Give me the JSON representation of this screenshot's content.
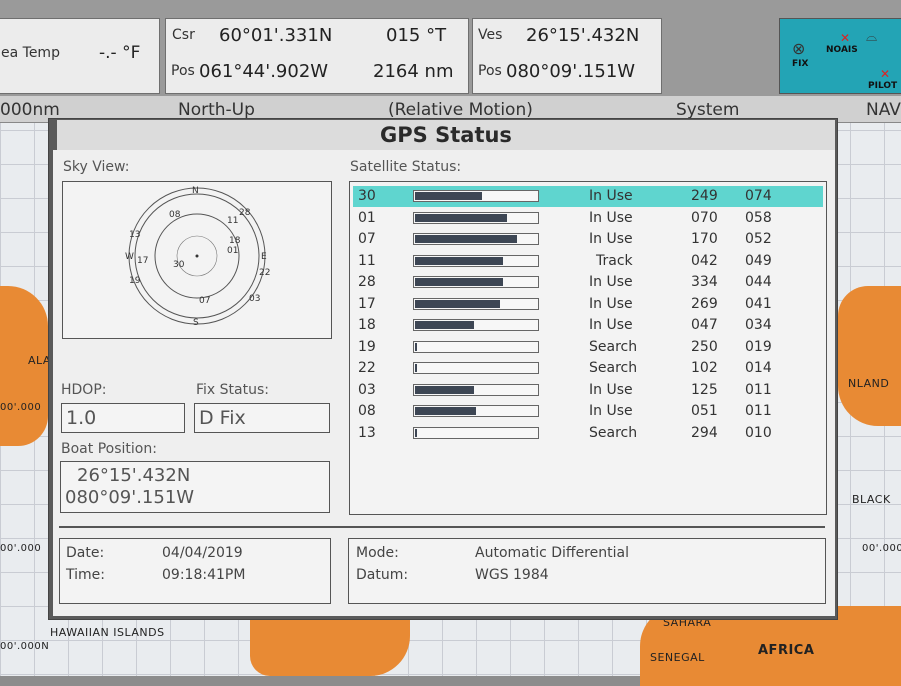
{
  "top_bar": {
    "sea_temp_label": "ea Temp",
    "sea_temp_value": "-.- °F",
    "csr_label": "Csr",
    "csr_lat": "60°01'.331N",
    "csr_course": "015 °T",
    "pos_label_1": "Pos",
    "csr_lon": "061°44'.902W",
    "csr_dist": "2164 nm",
    "ves_label": "Ves",
    "ves_lat": "26°15'.432N",
    "pos_label_2": "Pos",
    "ves_lon": "080°09'.151W",
    "fix_label": "FIX",
    "noais_label": "NOAIS",
    "pilot_label": "PILOT"
  },
  "chart_strip": {
    "range": "000nm",
    "orientation": "North-Up",
    "motion": "(Relative Motion)",
    "source": "System",
    "nav": "NAV"
  },
  "map_labels": {
    "ala": "ALA",
    "nland": "NLAND",
    "black": "BLACK",
    "hawaiian": "HAWAIIAN ISLANDS",
    "sahara": "SAHARA",
    "senegal": "SENEGAL",
    "africa": "AFRICA",
    "coord_1": "00'.000",
    "coord_2": "00'.000",
    "coord_3": "00'.000N",
    "coord_4": "00'.000"
  },
  "dialog": {
    "title": "GPS Status",
    "sky_view_label": "Sky View:",
    "satellite_status_label": "Satellite Status:",
    "compass": {
      "n": "N",
      "s": "S",
      "e": "E",
      "w": "W"
    },
    "sky_sats": [
      "08",
      "11",
      "13",
      "17",
      "30",
      "22",
      "03",
      "01",
      "07",
      "28",
      "18",
      "19"
    ],
    "hdop_label": "HDOP:",
    "hdop_value": "1.0",
    "fix_status_label": "Fix Status:",
    "fix_status_value": "D Fix",
    "boat_position_label": "Boat Position:",
    "boat_lat": "26°15'.432N",
    "boat_lon": "080°09'.151W",
    "date_label": "Date:",
    "date_value": "04/04/2019",
    "time_label": "Time:",
    "time_value": "09:18:41PM",
    "mode_label": "Mode:",
    "mode_value": "Automatic Differential",
    "datum_label": "Datum:",
    "datum_value": "WGS 1984"
  },
  "satellites": [
    {
      "prn": "30",
      "signal": 0.55,
      "status": "In Use",
      "azimuth": "249",
      "elevation": "074",
      "selected": true
    },
    {
      "prn": "01",
      "signal": 0.75,
      "status": "In Use",
      "azimuth": "070",
      "elevation": "058"
    },
    {
      "prn": "07",
      "signal": 0.84,
      "status": "In Use",
      "azimuth": "170",
      "elevation": "052"
    },
    {
      "prn": "11",
      "signal": 0.72,
      "status": "Track",
      "azimuth": "042",
      "elevation": "049"
    },
    {
      "prn": "28",
      "signal": 0.72,
      "status": "In Use",
      "azimuth": "334",
      "elevation": "044"
    },
    {
      "prn": "17",
      "signal": 0.7,
      "status": "In Use",
      "azimuth": "269",
      "elevation": "041"
    },
    {
      "prn": "18",
      "signal": 0.48,
      "status": "In Use",
      "azimuth": "047",
      "elevation": "034"
    },
    {
      "prn": "19",
      "signal": 0.02,
      "status": "Search",
      "azimuth": "250",
      "elevation": "019"
    },
    {
      "prn": "22",
      "signal": 0.02,
      "status": "Search",
      "azimuth": "102",
      "elevation": "014"
    },
    {
      "prn": "03",
      "signal": 0.48,
      "status": "In Use",
      "azimuth": "125",
      "elevation": "011"
    },
    {
      "prn": "08",
      "signal": 0.5,
      "status": "In Use",
      "azimuth": "051",
      "elevation": "011"
    },
    {
      "prn": "13",
      "signal": 0.02,
      "status": "Search",
      "azimuth": "294",
      "elevation": "010"
    }
  ]
}
